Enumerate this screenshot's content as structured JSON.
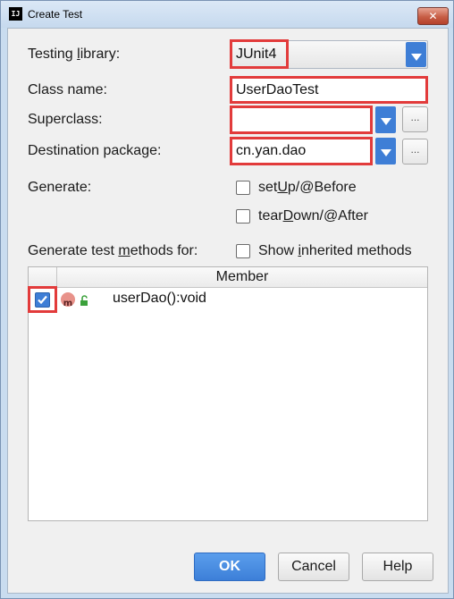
{
  "window": {
    "title": "Create Test",
    "app_icon": "IJ",
    "close_glyph": "✕"
  },
  "form": {
    "testing_library_label": "Testing library:",
    "testing_library_value": "JUnit4",
    "class_name_label": "Class name:",
    "class_name_value": "UserDaoTest",
    "superclass_label": "Superclass:",
    "superclass_value": "",
    "destination_label": "Destination package:",
    "destination_value": "cn.yan.dao",
    "browse_glyph": "…",
    "generate_label": "Generate:",
    "setup_label": "setUp/@Before",
    "setup_checked": false,
    "teardown_label": "tearDown/@After",
    "teardown_checked": false,
    "methods_label": "Generate test methods for:",
    "show_inherited_label": "Show inherited methods",
    "show_inherited_checked": false
  },
  "table": {
    "header": "Member",
    "rows": [
      {
        "checked": true,
        "badge": "m",
        "text": "userDao():void"
      }
    ]
  },
  "buttons": {
    "ok": "OK",
    "cancel": "Cancel",
    "help": "Help"
  },
  "colors": {
    "accent": "#3e7ed6",
    "highlight": "#e23b3b",
    "method_badge": "#e8928a",
    "lock_green": "#3ba13b"
  }
}
